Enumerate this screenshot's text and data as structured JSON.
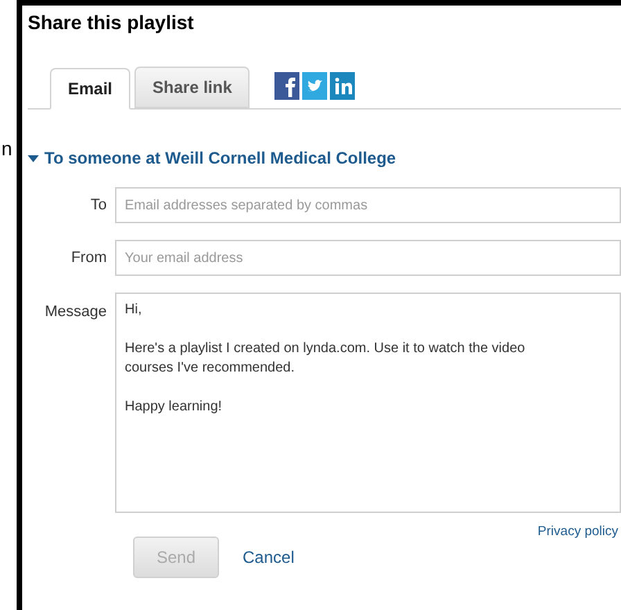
{
  "edge_text": "n",
  "title": "Share this playlist",
  "tabs": [
    {
      "label": "Email",
      "selected": true
    },
    {
      "label": "Share link",
      "selected": false
    }
  ],
  "social": [
    {
      "kind": "facebook",
      "color": "#3b5998"
    },
    {
      "kind": "twitter",
      "color": "#2fa9e0"
    },
    {
      "kind": "linkedin",
      "color": "#1c87bd"
    }
  ],
  "section": {
    "title": "To someone at Weill Cornell Medical College",
    "expanded": true
  },
  "fields": [
    {
      "label": "To",
      "placeholder": "Email addresses separated by commas"
    },
    {
      "label": "From",
      "placeholder": "Your email address"
    }
  ],
  "message": {
    "label": "Message",
    "value": "Hi,\n\nHere's a playlist I created on lynda.com. Use it to watch the video courses I've recommended.\n\nHappy learning!"
  },
  "privacy_link": "Privacy policy",
  "send": {
    "label": "Send",
    "disabled": true
  },
  "cancel": "Cancel"
}
